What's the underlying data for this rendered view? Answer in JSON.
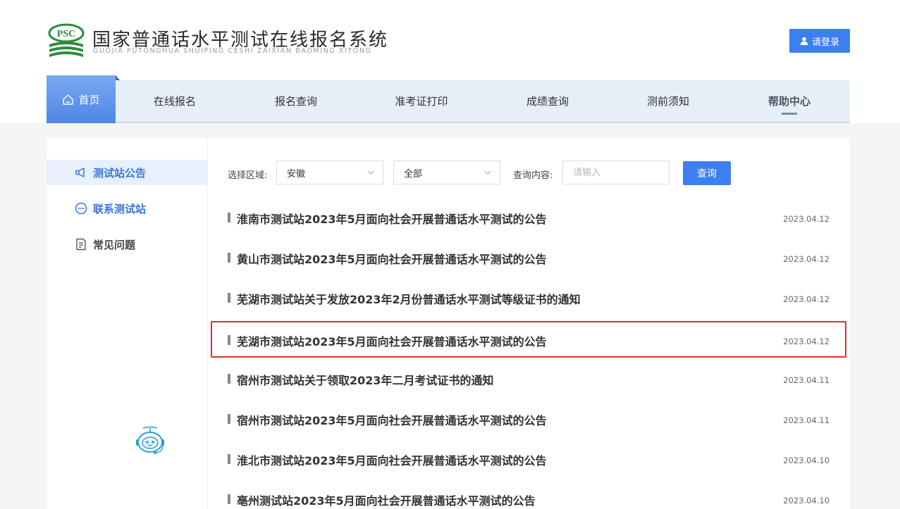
{
  "header": {
    "logo_text": "PSC",
    "title": "国家普通话水平测试在线报名系统",
    "subtitle": "GUOJIA PUTONGHUA SHUIPING CESHI ZAIXIAN BAOMING XITONG",
    "login_label": "请登录"
  },
  "nav": {
    "home": "首页",
    "items": [
      "在线报名",
      "报名查询",
      "准考证打印",
      "成绩查询",
      "测前须知",
      "帮助中心"
    ]
  },
  "sidebar": {
    "items": [
      "测试站公告",
      "联系测试站",
      "常见问题"
    ]
  },
  "filter": {
    "region_label": "选择区域:",
    "region_value": "安徽",
    "scope_value": "全部",
    "query_label": "查询内容:",
    "query_placeholder": "请输入",
    "query_button": "查询"
  },
  "news": [
    {
      "title": "淮南市测试站2023年5月面向社会开展普通话水平测试的公告",
      "date": "2023.04.12"
    },
    {
      "title": "黄山市测试站2023年5月面向社会开展普通话水平测试的公告",
      "date": "2023.04.12"
    },
    {
      "title": "芜湖市测试站关于发放2023年2月份普通话水平测试等级证书的通知",
      "date": "2023.04.12"
    },
    {
      "title": "芜湖市测试站2023年5月面向社会开展普通话水平测试的公告",
      "date": "2023.04.12"
    },
    {
      "title": "宿州市测试站关于领取2023年二月考试证书的通知",
      "date": "2023.04.11"
    },
    {
      "title": "宿州市测试站2023年5月面向社会开展普通话水平测试的公告",
      "date": "2023.04.11"
    },
    {
      "title": "淮北市测试站2023年5月面向社会开展普通话水平测试的公告",
      "date": "2023.04.10"
    },
    {
      "title": "亳州测试站2023年5月面向社会开展普通话水平测试的公告",
      "date": "2023.04.10"
    }
  ],
  "colors": {
    "accent": "#3d7ff0",
    "highlight_border": "#d6322e",
    "logo_green": "#2e8b3e"
  }
}
